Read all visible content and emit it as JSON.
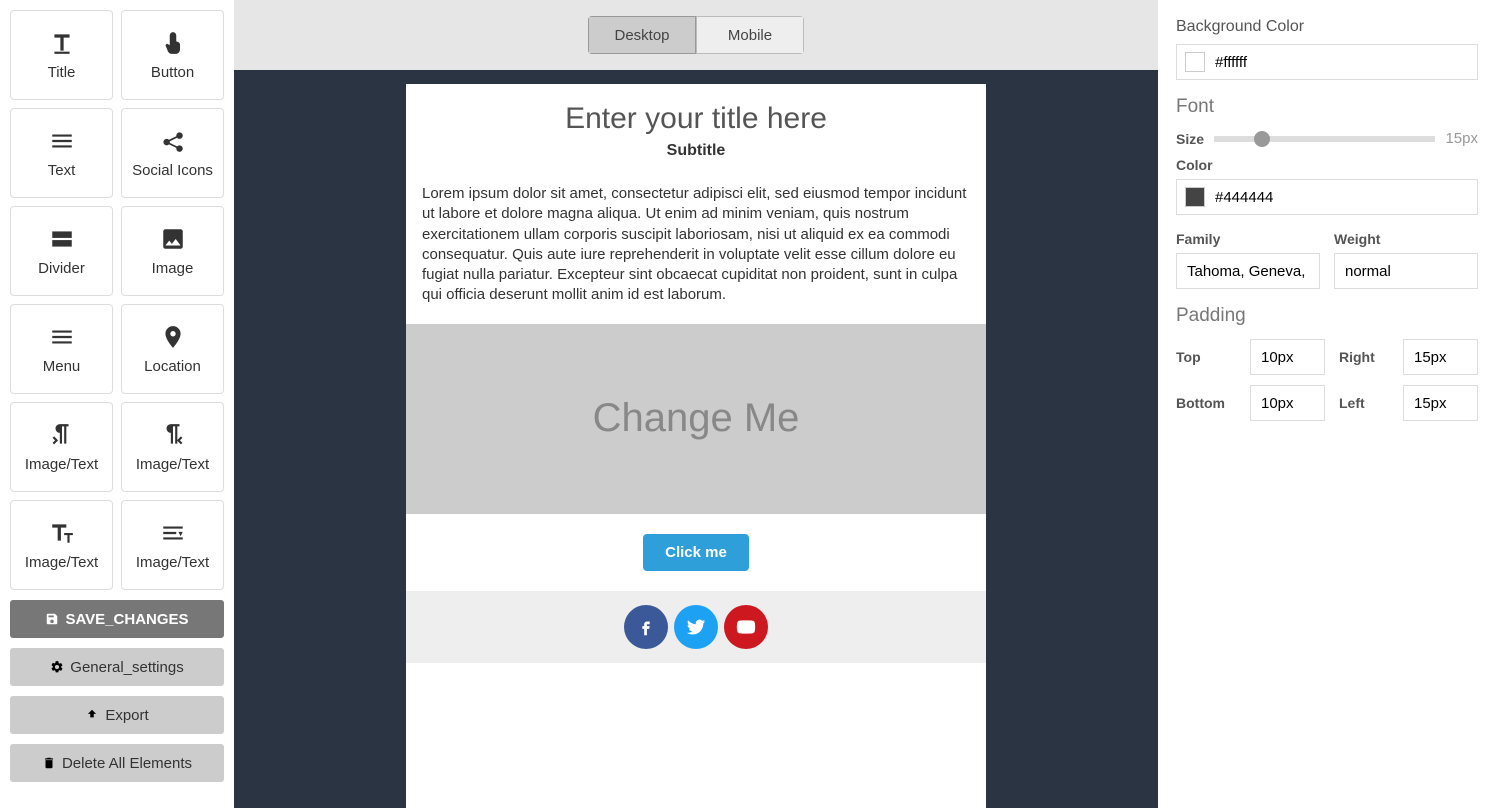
{
  "blocks": [
    {
      "id": "title",
      "label": "Title",
      "icon": "title"
    },
    {
      "id": "button",
      "label": "Button",
      "icon": "pointer"
    },
    {
      "id": "text",
      "label": "Text",
      "icon": "lines"
    },
    {
      "id": "social",
      "label": "Social Icons",
      "icon": "share"
    },
    {
      "id": "divider",
      "label": "Divider",
      "icon": "divider"
    },
    {
      "id": "image",
      "label": "Image",
      "icon": "image"
    },
    {
      "id": "menu",
      "label": "Menu",
      "icon": "menu"
    },
    {
      "id": "location",
      "label": "Location",
      "icon": "pin"
    },
    {
      "id": "imgtext-l",
      "label": "Image/Text",
      "icon": "para-l"
    },
    {
      "id": "imgtext-r",
      "label": "Image/Text",
      "icon": "para-r"
    },
    {
      "id": "imgtext-t",
      "label": "Image/Text",
      "icon": "tt"
    },
    {
      "id": "imgtext-wrap",
      "label": "Image/Text",
      "icon": "wrap"
    }
  ],
  "actions": {
    "save": "SAVE_CHANGES",
    "general": "General_settings",
    "export": "Export",
    "delete": "Delete All Elements"
  },
  "viewTabs": {
    "desktop": "Desktop",
    "mobile": "Mobile",
    "active": "desktop"
  },
  "preview": {
    "title": "Enter your title here",
    "subtitle": "Subtitle",
    "body": "Lorem ipsum dolor sit amet, consectetur adipisci elit, sed eiusmod tempor incidunt ut labore et dolore magna aliqua. Ut enim ad minim veniam, quis nostrum exercitationem ullam corporis suscipit laboriosam, nisi ut aliquid ex ea commodi consequatur. Quis aute iure reprehenderit in voluptate velit esse cillum dolore eu fugiat nulla pariatur. Excepteur sint obcaecat cupiditat non proident, sunt in culpa qui officia deserunt mollit anim id est laborum.",
    "imagePlaceholder": "Change Me",
    "button": "Click me"
  },
  "props": {
    "bgColorLabel": "Background Color",
    "bgColor": "#ffffff",
    "fontHeading": "Font",
    "sizeLabel": "Size",
    "sizeValue": "15px",
    "colorLabel": "Color",
    "fontColor": "#444444",
    "familyLabel": "Family",
    "family": "Tahoma, Geneva, sans-serif",
    "weightLabel": "Weight",
    "weight": "normal",
    "paddingHeading": "Padding",
    "padTopLabel": "Top",
    "padTop": "10px",
    "padRightLabel": "Right",
    "padRight": "15px",
    "padBottomLabel": "Bottom",
    "padBottom": "10px",
    "padLeftLabel": "Left",
    "padLeft": "15px"
  }
}
